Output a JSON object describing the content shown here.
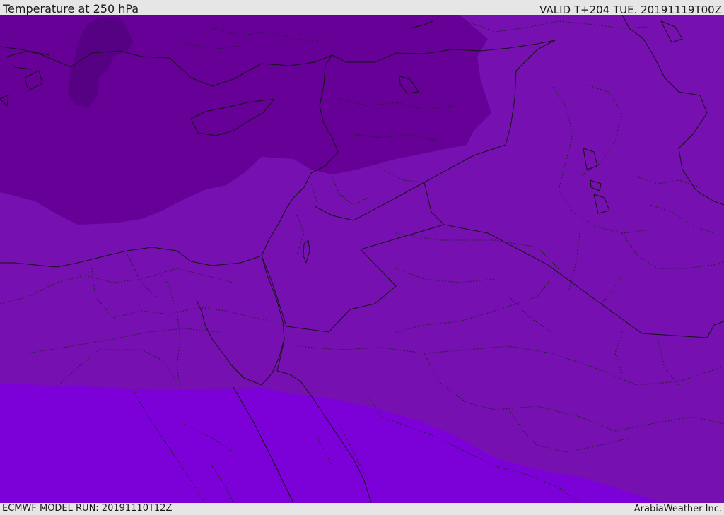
{
  "header": {
    "title": "Temperature at 250 hPa",
    "valid": "VALID T+204 TUE. 20191119T00Z"
  },
  "footer": {
    "model_run": "ECMWF MODEL RUN: 20191110T12Z",
    "credit": "ArabiaWeather Inc."
  },
  "map": {
    "field": "Temperature at 250 hPa",
    "colors": {
      "coldest_band": "#560084",
      "cold_band": "#660096",
      "middle_band": "#7710b0",
      "warm_band": "#7c00d8",
      "line_color": "#141414"
    }
  }
}
